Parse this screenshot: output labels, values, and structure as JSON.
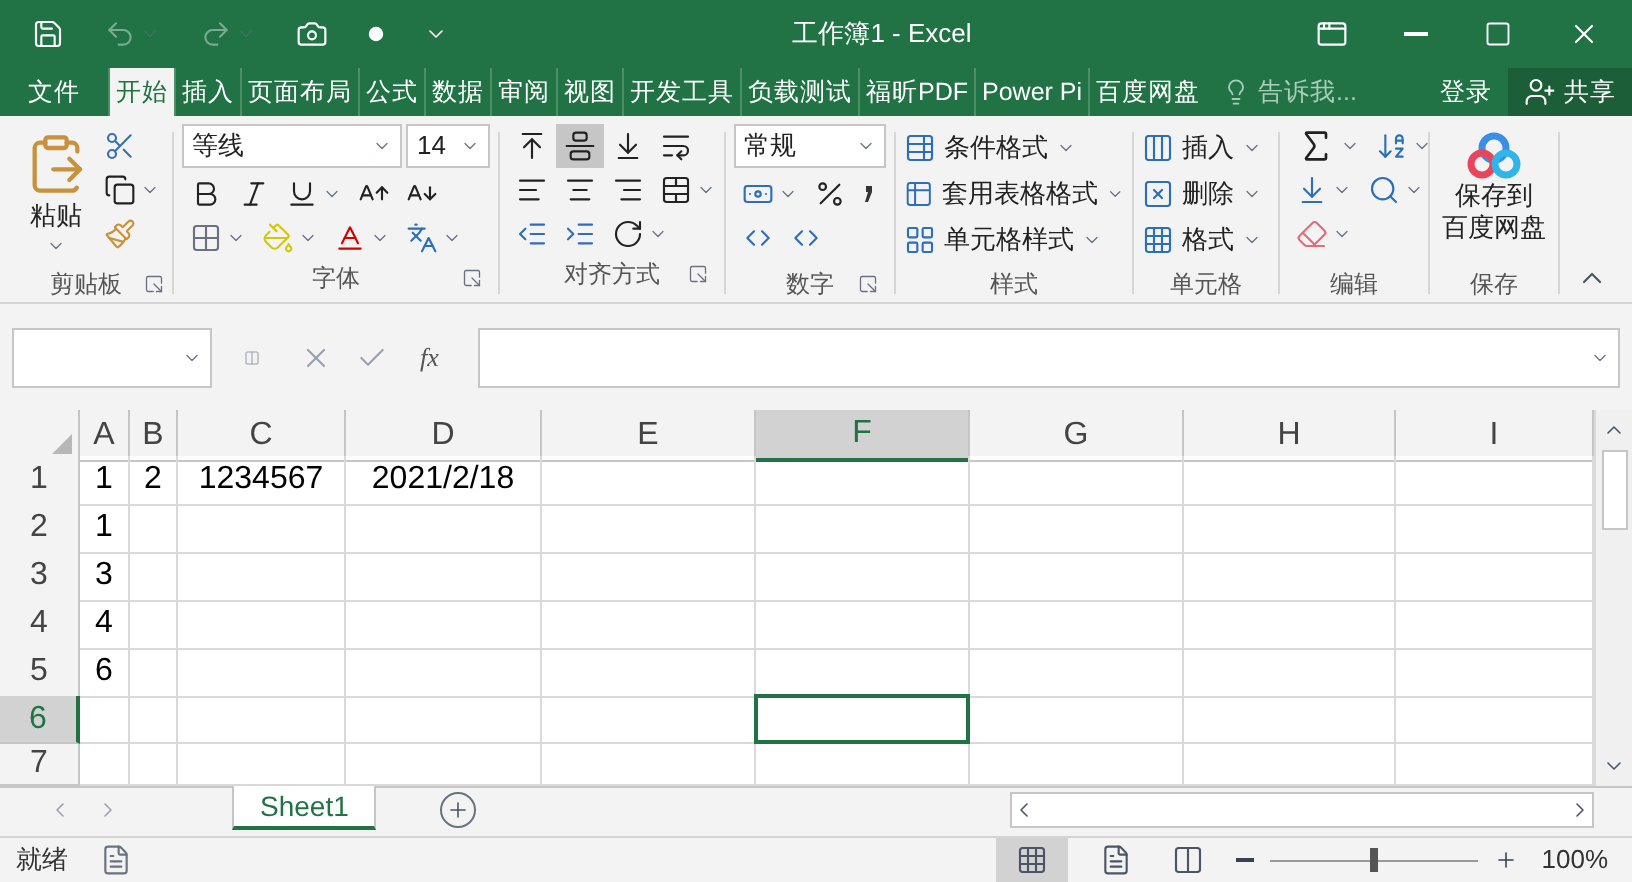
{
  "window": {
    "title": "工作簿1 - Excel"
  },
  "ribbon_tabs": [
    {
      "label": "文件",
      "selected": false
    },
    {
      "label": "开始",
      "selected": true
    },
    {
      "label": "插入",
      "selected": false
    },
    {
      "label": "页面布局",
      "selected": false
    },
    {
      "label": "公式",
      "selected": false
    },
    {
      "label": "数据",
      "selected": false
    },
    {
      "label": "审阅",
      "selected": false
    },
    {
      "label": "视图",
      "selected": false
    },
    {
      "label": "开发工具",
      "selected": false
    },
    {
      "label": "负载测试",
      "selected": false
    },
    {
      "label": "福昕PDF",
      "selected": false
    },
    {
      "label": "Power Pi",
      "selected": false
    },
    {
      "label": "百度网盘",
      "selected": false
    }
  ],
  "tell_me": {
    "placeholder": "告诉我..."
  },
  "sign_in": "登录",
  "share": "共享",
  "ribbon": {
    "clipboard": {
      "paste": "粘贴",
      "label": "剪贴板"
    },
    "font": {
      "font_name": "等线",
      "font_size": "14",
      "label": "字体"
    },
    "alignment": {
      "label": "对齐方式",
      "vertical": [
        {
          "kind": "top",
          "selected": false
        },
        {
          "kind": "middle",
          "selected": true
        },
        {
          "kind": "bottom",
          "selected": false
        }
      ]
    },
    "number": {
      "format": "常规",
      "label": "数字"
    },
    "styles": {
      "items": [
        "条件格式",
        "套用表格格式",
        "单元格样式"
      ],
      "label": "样式"
    },
    "cells": {
      "items": [
        "插入",
        "删除",
        "格式"
      ],
      "label": "单元格"
    },
    "editing": {
      "label": "编辑"
    },
    "baidu": {
      "button_lines": [
        "保存到",
        "百度网盘"
      ],
      "label": "保存"
    }
  },
  "formula_bar": {
    "function_button": "fx"
  },
  "sheet": {
    "columns": [
      {
        "label": "A",
        "selected": false
      },
      {
        "label": "B",
        "selected": false
      },
      {
        "label": "C",
        "selected": false
      },
      {
        "label": "D",
        "selected": false
      },
      {
        "label": "E",
        "selected": false
      },
      {
        "label": "F",
        "selected": true
      },
      {
        "label": "G",
        "selected": false
      },
      {
        "label": "H",
        "selected": false
      },
      {
        "label": "I",
        "selected": false
      }
    ],
    "rows": [
      {
        "label": "1",
        "selected": false,
        "cells": [
          "1",
          "2",
          "1234567",
          "2021/2/18"
        ]
      },
      {
        "label": "2",
        "selected": false,
        "cells": [
          "1"
        ]
      },
      {
        "label": "3",
        "selected": false,
        "cells": [
          "3"
        ]
      },
      {
        "label": "4",
        "selected": false,
        "cells": [
          "4"
        ]
      },
      {
        "label": "5",
        "selected": false,
        "cells": [
          "6"
        ]
      },
      {
        "label": "6",
        "selected": true,
        "cells": []
      },
      {
        "label": "7",
        "selected": false,
        "cells": []
      }
    ]
  },
  "sheet_tabs": [
    {
      "label": "Sheet1",
      "selected": true
    }
  ],
  "status_bar": {
    "status": "就绪",
    "zoom_slider": {
      "level": 0.5
    },
    "zoom": "100%"
  }
}
